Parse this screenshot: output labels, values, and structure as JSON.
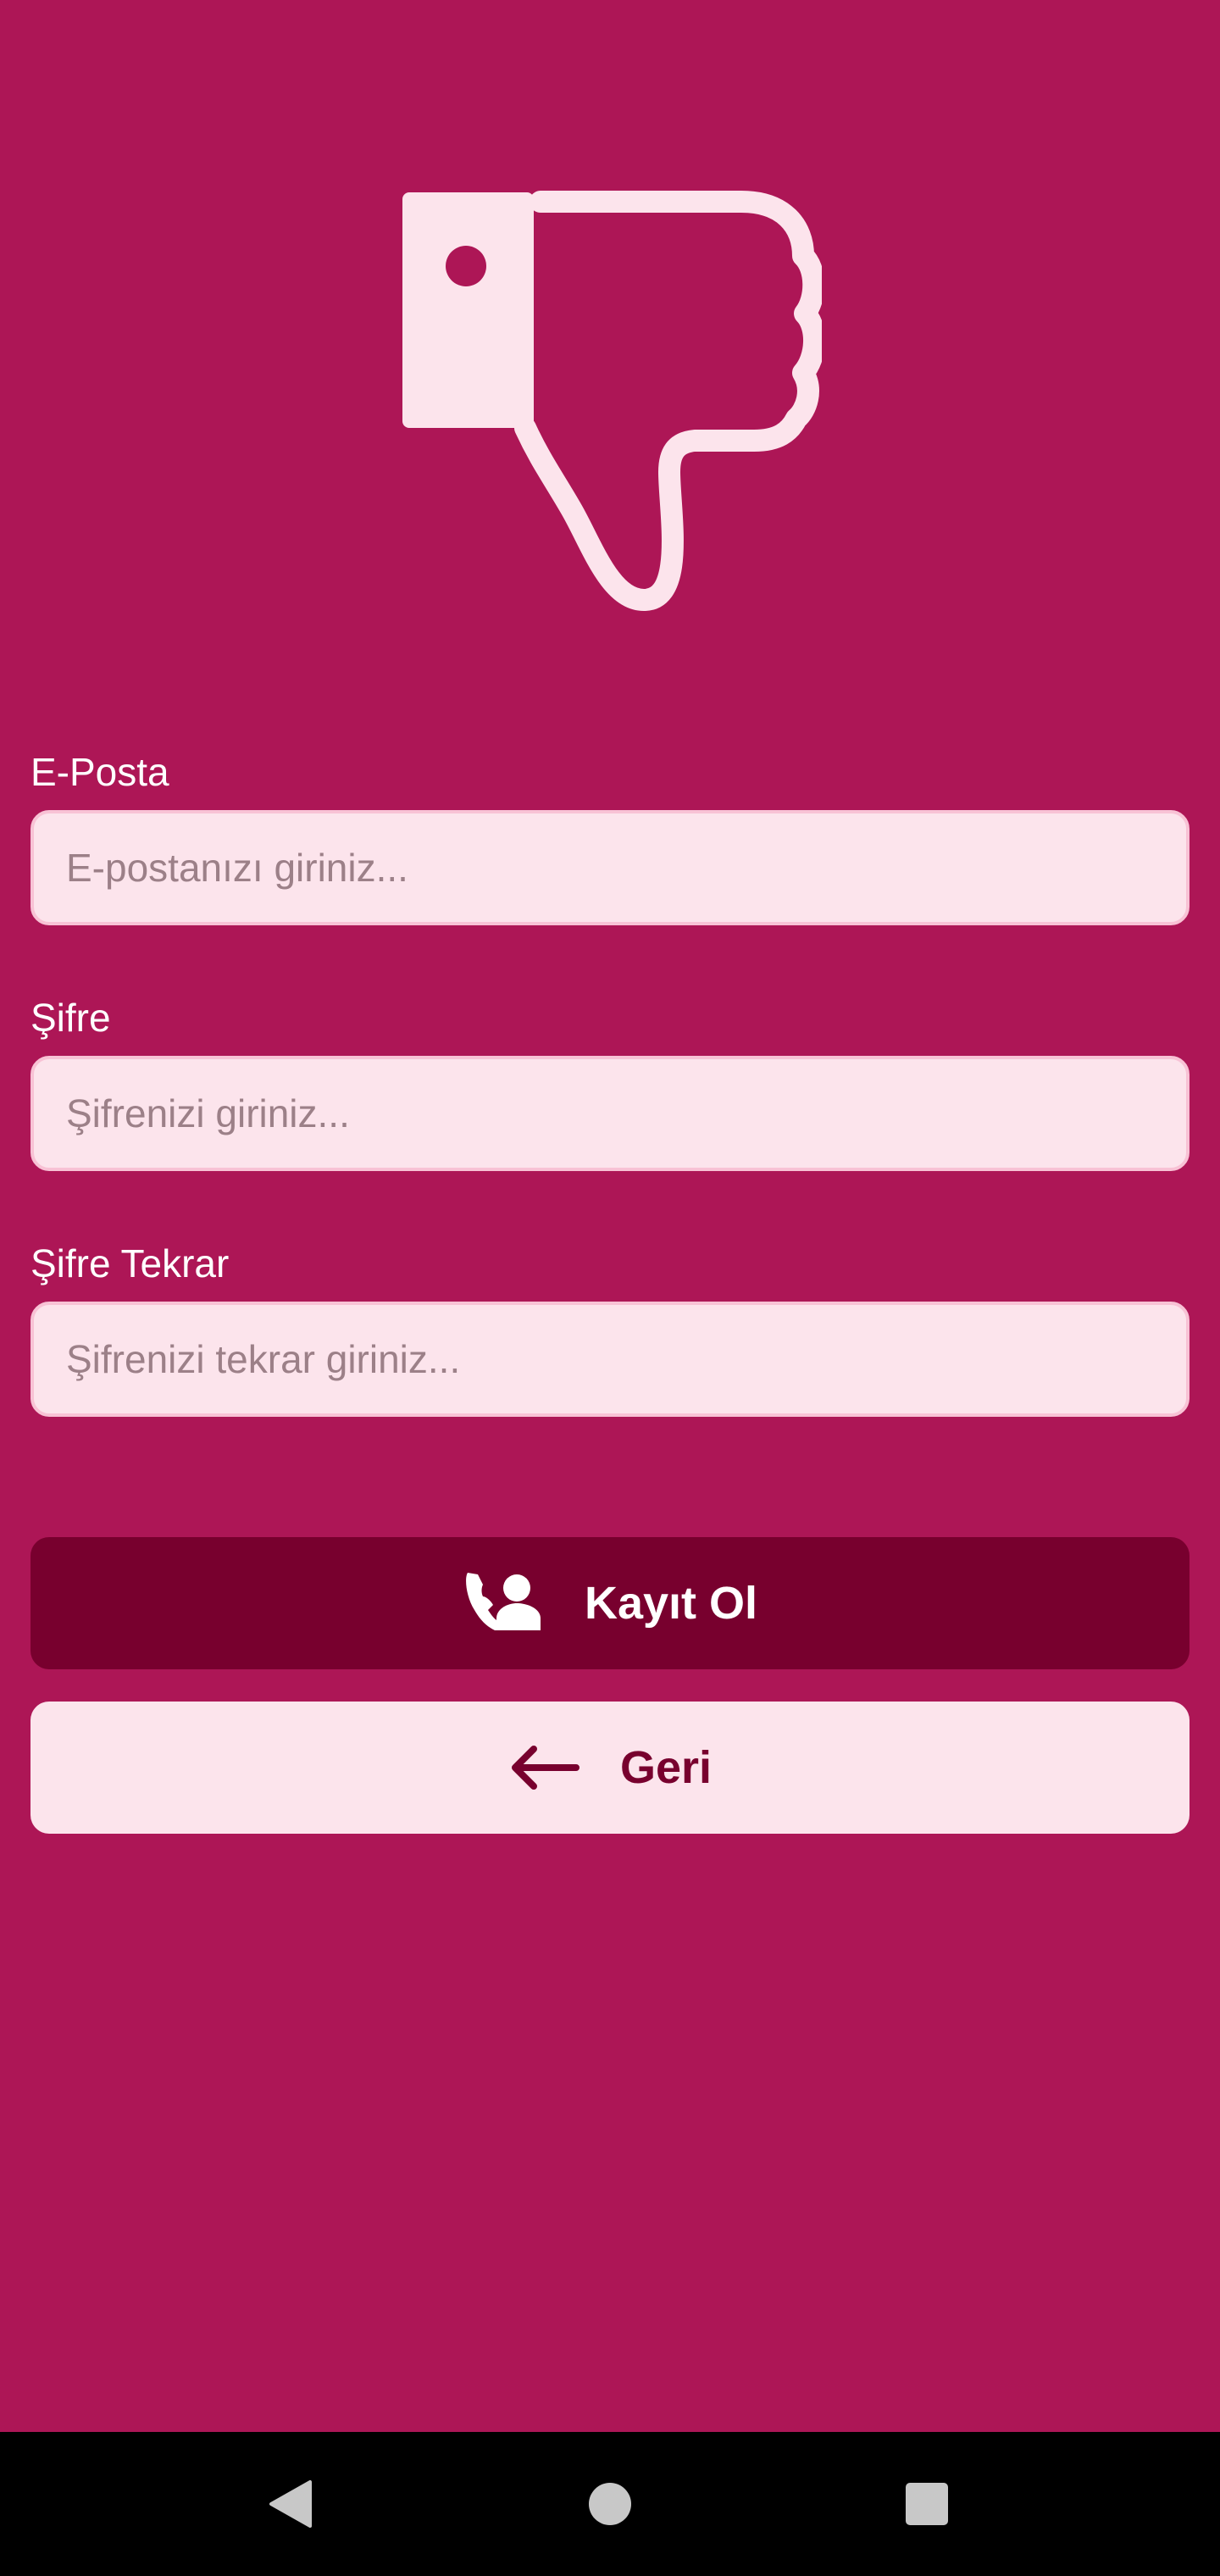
{
  "app": {
    "logo_icon": "thumbs-down-icon",
    "colors": {
      "background": "#ad1656",
      "primary_button": "#78002e",
      "input_background": "#fce4ec",
      "light_accent": "#fce4ec"
    }
  },
  "form": {
    "email": {
      "label": "E-Posta",
      "placeholder": "E-postanızı giriniz...",
      "value": ""
    },
    "password": {
      "label": "Şifre",
      "placeholder": "Şifrenizi giriniz...",
      "value": ""
    },
    "password_repeat": {
      "label": "Şifre Tekrar",
      "placeholder": "Şifrenizi tekrar giriniz...",
      "value": ""
    }
  },
  "actions": {
    "register": {
      "label": "Kayıt Ol",
      "icon": "person-add-icon"
    },
    "back": {
      "label": "Geri",
      "icon": "arrow-left-icon"
    }
  },
  "navbar": {
    "back_icon": "nav-back-icon",
    "home_icon": "nav-home-icon",
    "recents_icon": "nav-recents-icon"
  }
}
